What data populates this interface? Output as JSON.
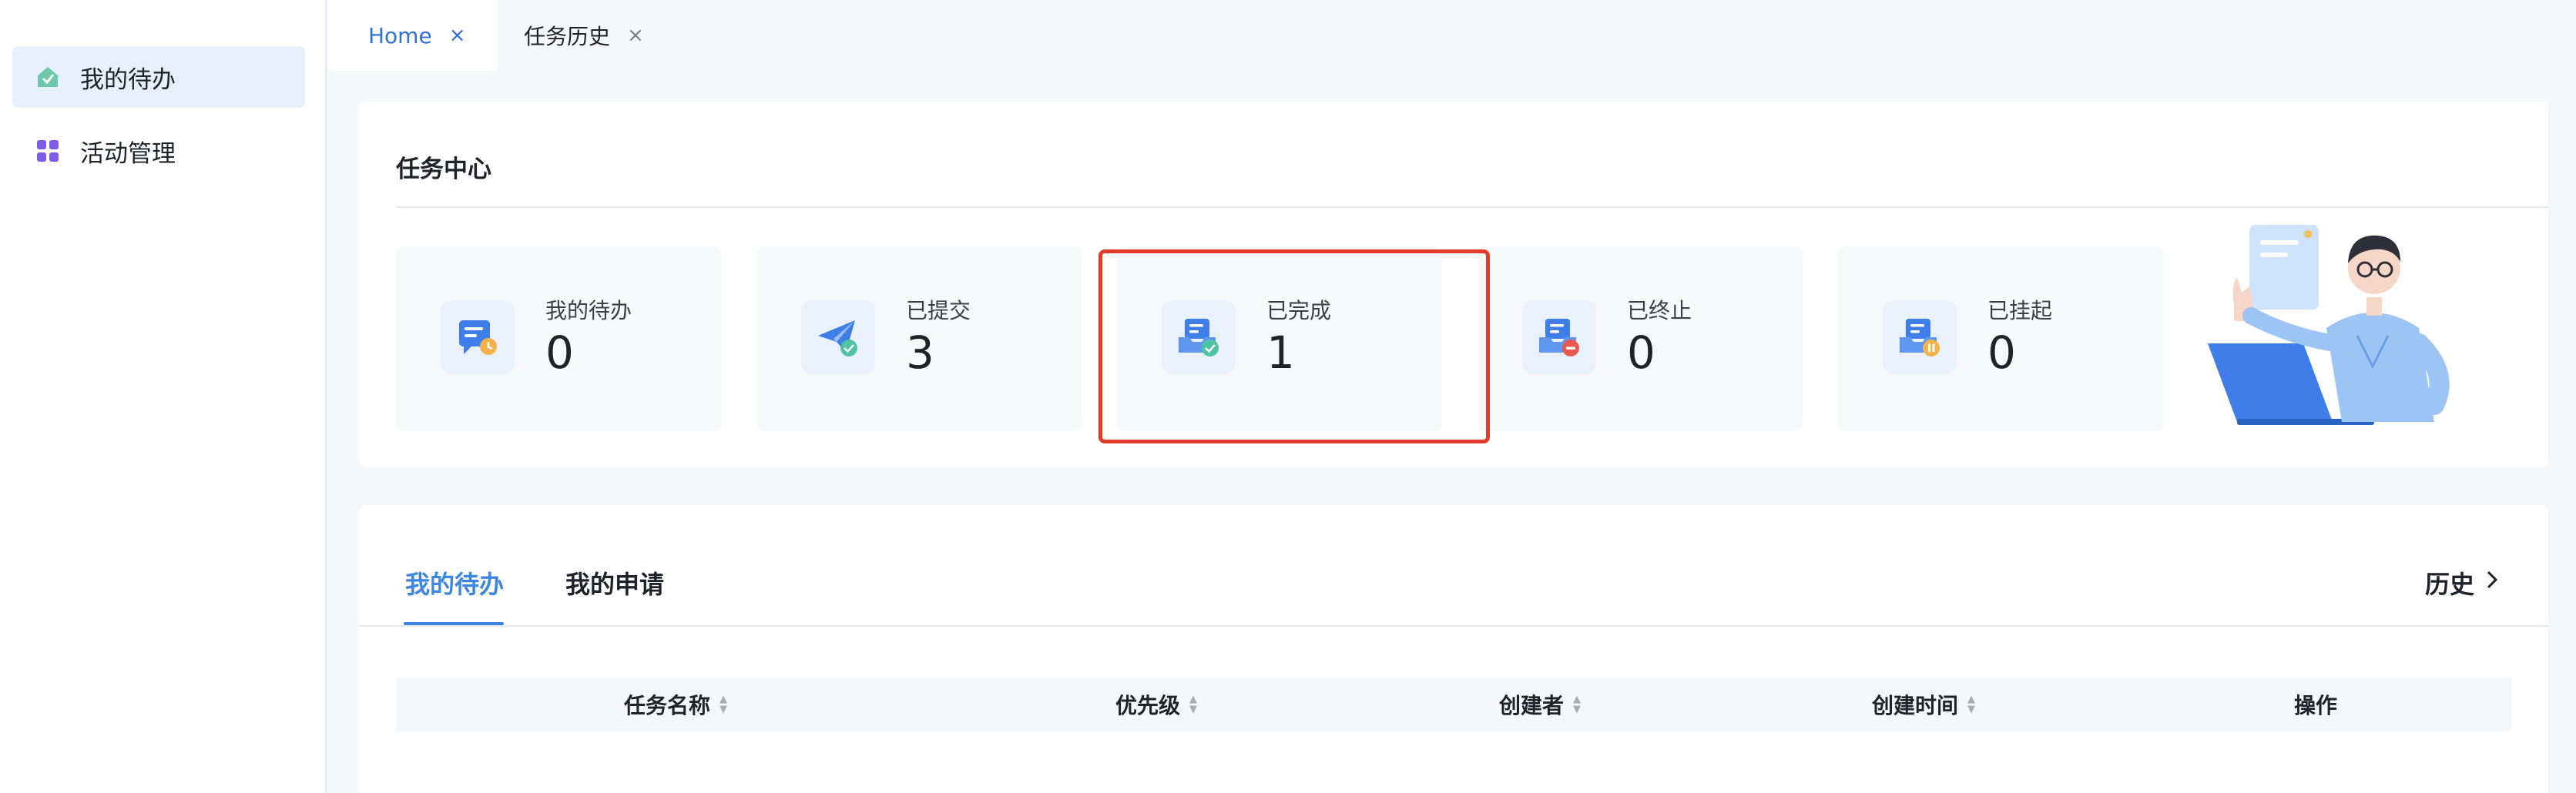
{
  "sidebar": {
    "items": [
      {
        "label": "我的待办",
        "icon": "home-check-icon",
        "active": true
      },
      {
        "label": "活动管理",
        "icon": "grid-apps-icon",
        "active": false
      }
    ]
  },
  "tabs": [
    {
      "label": "Home",
      "close": "×",
      "active": true
    },
    {
      "label": "任务历史",
      "close": "×",
      "active": false
    }
  ],
  "task_center": {
    "title": "任务中心",
    "stats": [
      {
        "label": "我的待办",
        "value": "0",
        "icon": "todo-clock-icon"
      },
      {
        "label": "已提交",
        "value": "3",
        "icon": "paper-plane-check-icon"
      },
      {
        "label": "已完成",
        "value": "1",
        "icon": "inbox-check-icon"
      },
      {
        "label": "已终止",
        "value": "0",
        "icon": "inbox-stop-icon"
      },
      {
        "label": "已挂起",
        "value": "0",
        "icon": "inbox-pause-icon"
      }
    ],
    "highlighted_stat": "已完成",
    "highlight_color": "#e23b2a"
  },
  "list": {
    "tabs": [
      {
        "label": "我的待办",
        "active": true
      },
      {
        "label": "我的申请",
        "active": false
      }
    ],
    "history_label": "历史",
    "history_icon": "chevron-right-icon",
    "columns": [
      {
        "label": "任务名称",
        "sortable": true
      },
      {
        "label": "优先级",
        "sortable": true
      },
      {
        "label": "创建者",
        "sortable": true
      },
      {
        "label": "创建时间",
        "sortable": true
      },
      {
        "label": "操作",
        "sortable": false
      }
    ]
  },
  "colors": {
    "accent": "#3a86e0",
    "tab_active_text": "#2f6fde",
    "sidebar_active_bg": "#e6f0fc"
  }
}
